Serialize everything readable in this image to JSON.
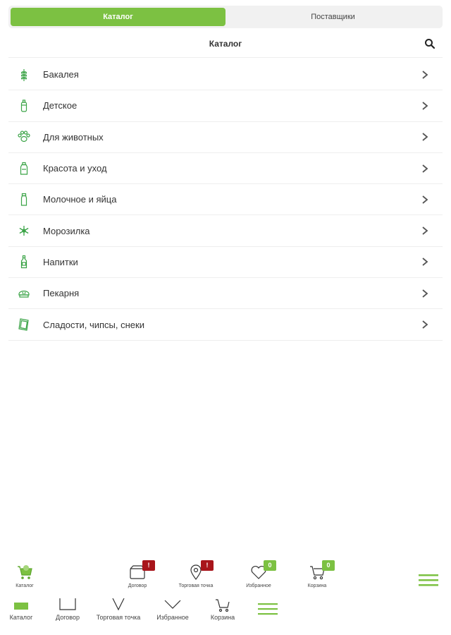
{
  "segmented": {
    "tabs": [
      {
        "label": "Каталог",
        "active": true
      },
      {
        "label": "Поставщики",
        "active": false
      }
    ]
  },
  "header": {
    "title": "Каталог",
    "search_icon": "search-icon"
  },
  "categories": [
    {
      "label": "Бакалея",
      "icon": "wheat-icon"
    },
    {
      "label": "Детское",
      "icon": "baby-bottle-icon"
    },
    {
      "label": "Для животных",
      "icon": "paw-icon"
    },
    {
      "label": "Красота и уход",
      "icon": "cosmetics-bottle-icon"
    },
    {
      "label": "Молочное и яйца",
      "icon": "milk-bottle-icon"
    },
    {
      "label": "Морозилка",
      "icon": "snowflake-icon"
    },
    {
      "label": "Напитки",
      "icon": "drink-bottle-icon"
    },
    {
      "label": "Пекарня",
      "icon": "bread-icon"
    },
    {
      "label": "Сладости, чипсы, снеки",
      "icon": "snack-pack-icon"
    }
  ],
  "bottom_nav": {
    "items": [
      {
        "label": "Каталог",
        "icon": "catalog-cart-icon"
      },
      {
        "label": "Договор",
        "icon": "contract-icon",
        "badge": "!"
      },
      {
        "label": "Торговая точка",
        "icon": "location-pin-icon",
        "badge": "!"
      },
      {
        "label": "Избранное",
        "icon": "heart-icon",
        "badge": "0"
      },
      {
        "label": "Корзина",
        "icon": "cart-icon",
        "badge": "0"
      }
    ],
    "menu_icon": "hamburger-menu-icon"
  },
  "ghost_nav": {
    "items": [
      {
        "label": "Каталог"
      },
      {
        "label": "Договор"
      },
      {
        "label": "Торговая точка"
      },
      {
        "label": "Избранное"
      },
      {
        "label": "Корзина"
      }
    ]
  },
  "colors": {
    "accent": "#7cc142",
    "badge_red": "#a8151b",
    "text": "#333333",
    "divider": "#eeeeee"
  }
}
